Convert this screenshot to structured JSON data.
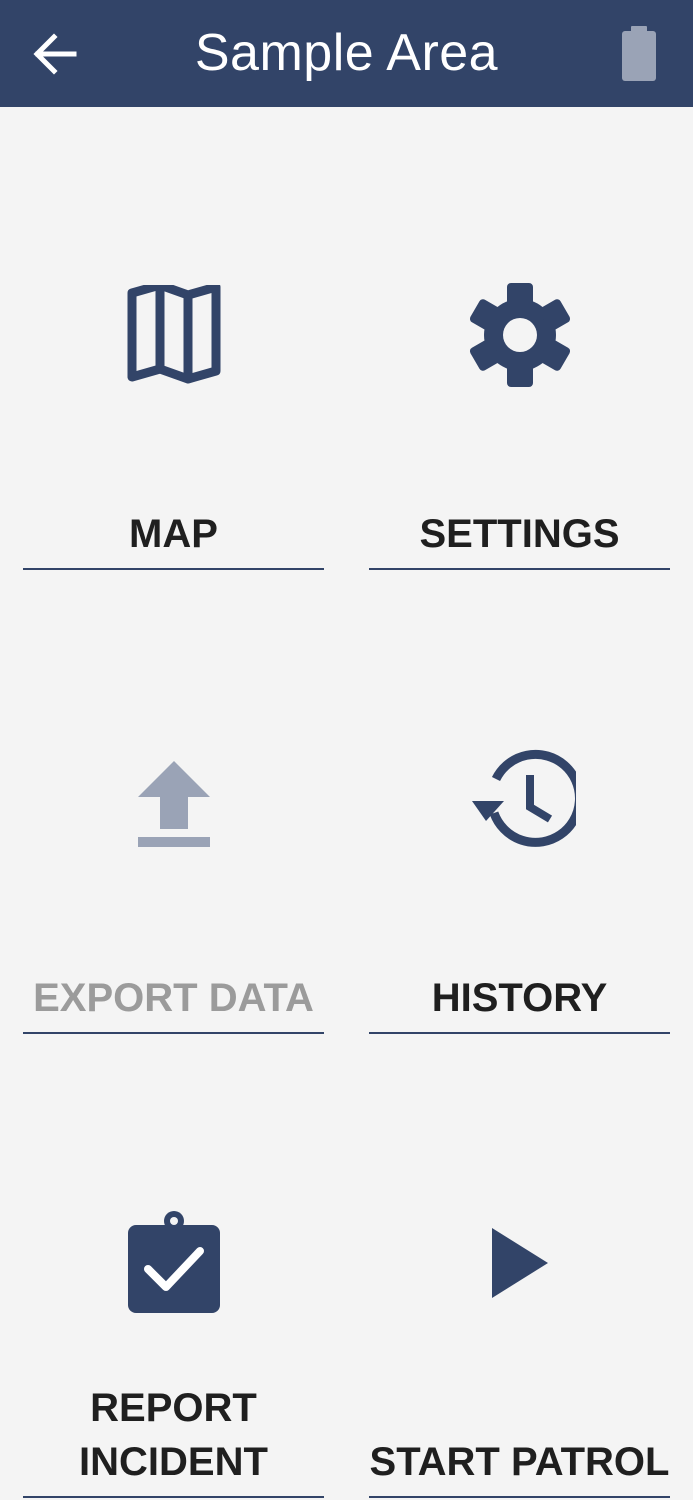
{
  "header": {
    "title": "Sample Area",
    "back_icon": "arrow-left-icon",
    "battery_icon": "battery-icon"
  },
  "colors": {
    "primary": "#324468",
    "disabled_icon": "#9aa3b6",
    "disabled_text": "#9b9b9b",
    "background": "#f4f4f4"
  },
  "tiles": {
    "map": {
      "label": "MAP",
      "icon": "map-icon",
      "enabled": true
    },
    "settings": {
      "label": "SETTINGS",
      "icon": "gear-icon",
      "enabled": true
    },
    "export": {
      "label": "EXPORT DATA",
      "icon": "upload-icon",
      "enabled": false
    },
    "history": {
      "label": "HISTORY",
      "icon": "history-icon",
      "enabled": true
    },
    "report": {
      "label_line1": "REPORT",
      "label_line2": "INCIDENT",
      "icon": "clipboard-check-icon",
      "enabled": true
    },
    "patrol": {
      "label": "START PATROL",
      "icon": "play-icon",
      "enabled": true
    }
  }
}
